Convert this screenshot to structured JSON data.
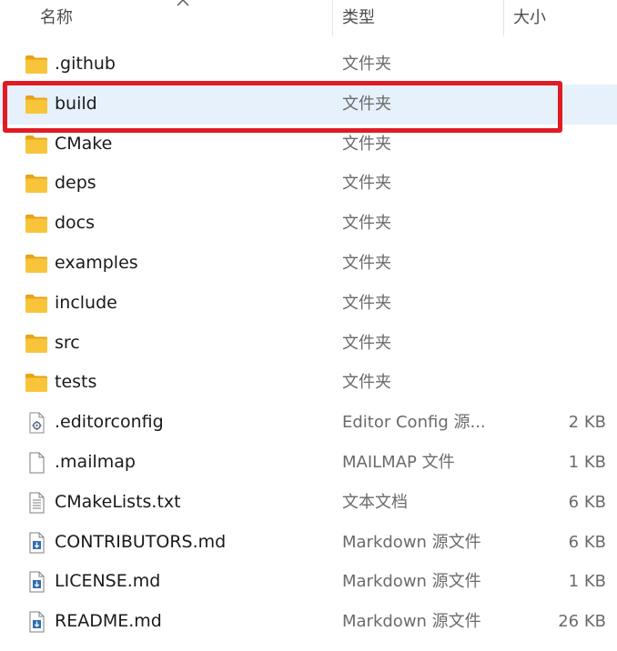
{
  "header": {
    "name_label": "名称",
    "type_label": "类型",
    "size_label": "大小"
  },
  "files": [
    {
      "name": ".github",
      "type": "文件夹",
      "size": "",
      "icon": "folder-icon"
    },
    {
      "name": "build",
      "type": "文件夹",
      "size": "",
      "icon": "folder-icon",
      "selected": true
    },
    {
      "name": "CMake",
      "type": "文件夹",
      "size": "",
      "icon": "folder-icon"
    },
    {
      "name": "deps",
      "type": "文件夹",
      "size": "",
      "icon": "folder-icon"
    },
    {
      "name": "docs",
      "type": "文件夹",
      "size": "",
      "icon": "folder-icon"
    },
    {
      "name": "examples",
      "type": "文件夹",
      "size": "",
      "icon": "folder-icon"
    },
    {
      "name": "include",
      "type": "文件夹",
      "size": "",
      "icon": "folder-icon"
    },
    {
      "name": "src",
      "type": "文件夹",
      "size": "",
      "icon": "folder-icon"
    },
    {
      "name": "tests",
      "type": "文件夹",
      "size": "",
      "icon": "folder-icon"
    },
    {
      "name": ".editorconfig",
      "type": "Editor Config 源...",
      "size": "2 KB",
      "icon": "config-file-icon"
    },
    {
      "name": ".mailmap",
      "type": "MAILMAP 文件",
      "size": "1 KB",
      "icon": "blank-file-icon"
    },
    {
      "name": "CMakeLists.txt",
      "type": "文本文档",
      "size": "6 KB",
      "icon": "text-file-icon"
    },
    {
      "name": "CONTRIBUTORS.md",
      "type": "Markdown 源文件",
      "size": "6 KB",
      "icon": "markdown-file-icon"
    },
    {
      "name": "LICENSE.md",
      "type": "Markdown 源文件",
      "size": "1 KB",
      "icon": "markdown-file-icon"
    },
    {
      "name": "README.md",
      "type": "Markdown 源文件",
      "size": "26 KB",
      "icon": "markdown-file-icon"
    }
  ],
  "colors": {
    "highlight_border": "#e01b24",
    "selected_row": "#e6f1fb",
    "folder_yellow": "#f8c53a"
  }
}
